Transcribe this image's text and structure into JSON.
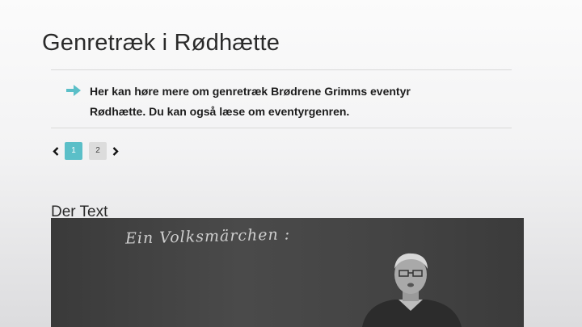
{
  "page": {
    "title": "Genretræk i Rødhætte"
  },
  "intro": {
    "icon": "arrow-right-icon",
    "text_line1": "Her kan høre mere om genretræk Brødrene Grimms eventyr",
    "text_line2": "Rødhætte. Du kan også læse om eventyrgenren."
  },
  "pagination": {
    "pages": [
      "1",
      "2"
    ],
    "active_page": "1",
    "prev_icon": "chevron-left-icon",
    "next_icon": "chevron-right-icon"
  },
  "section": {
    "heading": "Der Text"
  },
  "video": {
    "chalkboard_text": "Ein Volksmärchen :"
  },
  "colors": {
    "accent": "#5bbfc8",
    "arrow": "#5bbfc8"
  }
}
